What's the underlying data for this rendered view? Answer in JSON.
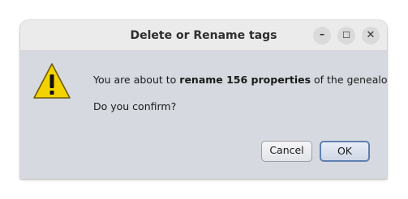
{
  "dialog": {
    "title": "Delete or Rename tags",
    "window_controls": {
      "minimize_glyph": "–",
      "maximize_glyph": "☐",
      "close_glyph": "✕"
    },
    "icon": "warning-icon",
    "message": {
      "prefix": "You are about to ",
      "emphasis": "rename 156 properties",
      "suffix": " of the genealogy."
    },
    "question": "Do you confirm?",
    "buttons": {
      "cancel_label": "Cancel",
      "ok_label": "OK"
    }
  },
  "colors": {
    "warning_fill": "#f2d300",
    "warning_border": "#6d5a00",
    "default_button_border": "#5f80b0",
    "dialog_background": "#d6d9e0"
  }
}
